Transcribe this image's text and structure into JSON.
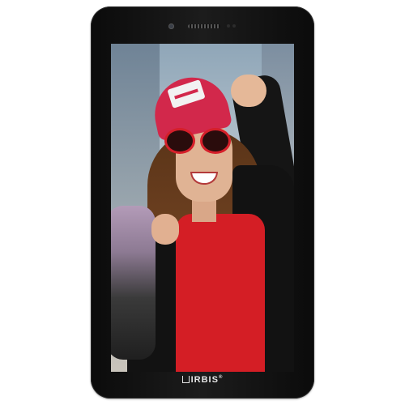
{
  "device": {
    "brand_label": "IRBIS",
    "trademark": "®"
  },
  "screen": {
    "content": "photo"
  }
}
